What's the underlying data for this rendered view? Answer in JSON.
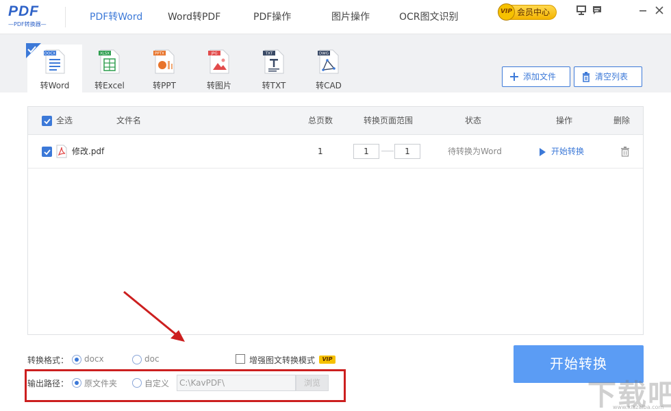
{
  "logo": {
    "main": "PDF",
    "sub": "—PDF转换器—"
  },
  "tabs": [
    {
      "label": "PDF转Word",
      "active": true
    },
    {
      "label": "Word转PDF",
      "active": false
    },
    {
      "label": "PDF操作",
      "active": false
    },
    {
      "label": "图片操作",
      "active": false
    },
    {
      "label": "OCR图文识别",
      "active": false
    }
  ],
  "vip": {
    "badge": "VIP",
    "label": "会员中心"
  },
  "window_icons": [
    "monitor-icon",
    "message-icon",
    "minimize-icon",
    "close-icon"
  ],
  "formats": [
    {
      "label": "转Word",
      "tag": "DOCX",
      "color": "#3c79d8",
      "active": true
    },
    {
      "label": "转Excel",
      "tag": "XLSX",
      "color": "#2e9e4f",
      "active": false
    },
    {
      "label": "转PPT",
      "tag": "PPTX",
      "color": "#e8742b",
      "active": false
    },
    {
      "label": "转图片",
      "tag": "JPG",
      "color": "#e24b4b",
      "active": false
    },
    {
      "label": "转TXT",
      "tag": "TXT",
      "color": "#3a4a66",
      "active": false
    },
    {
      "label": "转CAD",
      "tag": "DWG",
      "color": "#3a4a66",
      "active": false
    }
  ],
  "toolbar": {
    "add_label": "添加文件",
    "clear_label": "清空列表"
  },
  "table": {
    "headers": {
      "select_all": "全选",
      "filename": "文件名",
      "pages": "总页数",
      "range": "转换页面范围",
      "status": "状态",
      "action": "操作",
      "delete": "删除"
    },
    "rows": [
      {
        "checked": true,
        "filename": "修改.pdf",
        "pages": "1",
        "range_from": "1",
        "range_to": "1",
        "status": "待转换为Word",
        "action": "开始转换"
      }
    ]
  },
  "options": {
    "format_label": "转换格式：",
    "format_docx": "docx",
    "format_doc": "doc",
    "format_selected": "docx",
    "enhance_label": "增强图文转换模式",
    "enhance_vip": "VIP",
    "output_label": "输出路径：",
    "output_original": "原文件夹",
    "output_custom": "自定义",
    "output_selected": "原文件夹",
    "path_value": "C:\\KavPDF\\",
    "browse_label": "浏览"
  },
  "start_button": "开始转换",
  "watermark": {
    "text": "下载吧",
    "url": "www.xiazaiba.com"
  },
  "colors": {
    "accent": "#3c79d8",
    "start_button": "#5b9cf4",
    "annotation": "#cc1f1f"
  }
}
